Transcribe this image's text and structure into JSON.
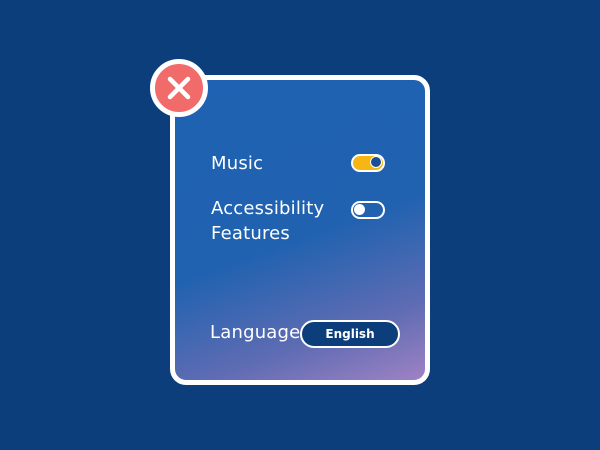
{
  "settings": {
    "close_icon": "close-icon",
    "music": {
      "label": "Music",
      "enabled": true
    },
    "accessibility": {
      "label_line1": "Accessibility",
      "label_line2": "Features",
      "enabled": false
    },
    "language": {
      "label": "Language",
      "value": "English"
    }
  },
  "colors": {
    "background": "#0b3e7a",
    "panel_border": "#ffffff",
    "close_button": "#f26b6b",
    "toggle_on": "#f6b613"
  }
}
